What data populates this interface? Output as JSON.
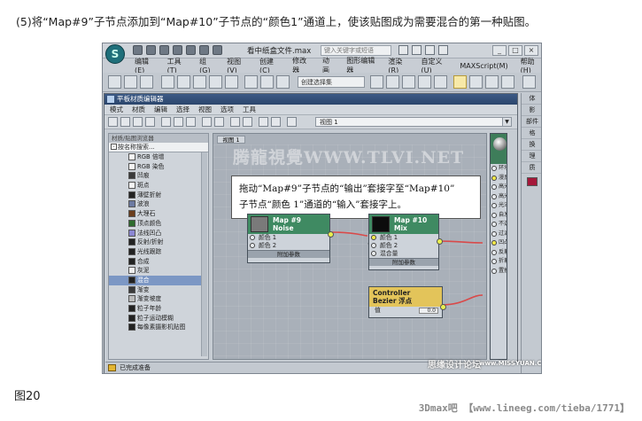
{
  "caption": "(5)将“Map#9”子节点添加到“Map#10”子节点的“颜色1”通道上，使该贴图成为需要混合的第一种贴图。",
  "figure_label": "图20",
  "footer_watermark": "3Dmax吧 【www.lineeg.com/tieba/1771】",
  "max_window": {
    "doc_title": "看中纸盒文件.max",
    "help_search_placeholder": "键入关键字或短语",
    "menu": [
      "编辑(E)",
      "工具(T)",
      "组(G)",
      "视图(V)",
      "创建(C)",
      "修改器",
      "动画",
      "图形编辑器",
      "渲染(R)",
      "自定义(U)",
      "MAXScript(M)",
      "帮助(H)"
    ],
    "selection_set_placeholder": "创建选择集"
  },
  "slate": {
    "title": "平板材质编辑器",
    "menu": [
      "模式",
      "材质",
      "编辑",
      "选择",
      "视图",
      "选项",
      "工具"
    ],
    "view_dropdown": "视图 1",
    "browser_header": "材质/贴图浏览器",
    "search_placeholder": "按名称搜索...",
    "map_items": [
      {
        "label": "RGB 倍增",
        "color": "#f4f4f4"
      },
      {
        "label": "RGB 染色",
        "color": "#f4f4f4"
      },
      {
        "label": "凹痕",
        "color": "#3b3b3b"
      },
      {
        "label": "斑点",
        "color": "#f4f4f4"
      },
      {
        "label": "薄壁折射",
        "color": "#222222"
      },
      {
        "label": "波浪",
        "color": "#6c7aa2"
      },
      {
        "label": "大理石",
        "color": "#6b3e1d"
      },
      {
        "label": "顶点颜色",
        "color": "#2d6b2d"
      },
      {
        "label": "法线凹凸",
        "color": "#8a86d2"
      },
      {
        "label": "反射/折射",
        "color": "#222222"
      },
      {
        "label": "光线跟踪",
        "color": "#222222"
      },
      {
        "label": "合成",
        "color": "#222222"
      },
      {
        "label": "灰泥",
        "color": "#eeeeee"
      },
      {
        "label": "混合",
        "color": "#222222",
        "selected": true
      },
      {
        "label": "渐变",
        "color": "#3a3a3a"
      },
      {
        "label": "渐变坡度",
        "color": "#bbbbbb"
      },
      {
        "label": "粒子年龄",
        "color": "#222222"
      },
      {
        "label": "粒子运动模糊",
        "color": "#222222"
      },
      {
        "label": "每像素摄影机贴图",
        "color": "#222222"
      }
    ],
    "view_tab": "视图 1",
    "view_watermark": "腾龍視覺WWW.TLVI.NET",
    "callout_line1": "拖动“Map#9”子节点的“输出”套接字至“Map#10”",
    "callout_line2": "子节点“颜色 1”通道的“输入”套接字上。",
    "nodes": {
      "map9": {
        "title": "Map #9",
        "type": "Noise",
        "slots": [
          "颜色 1",
          "颜色 2"
        ],
        "footer": "附加参数",
        "color": "#3f8a62"
      },
      "map10": {
        "title": "Map #10",
        "type": "Mix",
        "slots": [
          "颜色 1",
          "颜色 2",
          "混合量"
        ],
        "footer": "附加参数",
        "color": "#3f8a62"
      },
      "controller": {
        "title": "Controller",
        "type": "Bezier 浮点",
        "slot": "值",
        "value": "0.0",
        "color": "#e3c45a"
      }
    },
    "right_node_slots": [
      "环境光颜色",
      "漫反射颜色",
      "高光颜色",
      "高光级别",
      "光泽度",
      "自发光",
      "不透明度",
      "过滤色",
      "凹凸",
      "反射",
      "折射",
      "置换"
    ],
    "right_panel": [
      "体",
      "影",
      "部件",
      "格",
      "换",
      "理",
      "质"
    ],
    "status_text": "已完成准备",
    "site_mark": "思缘设计论坛",
    "site_url": "www.MISSYUAN.COM"
  }
}
